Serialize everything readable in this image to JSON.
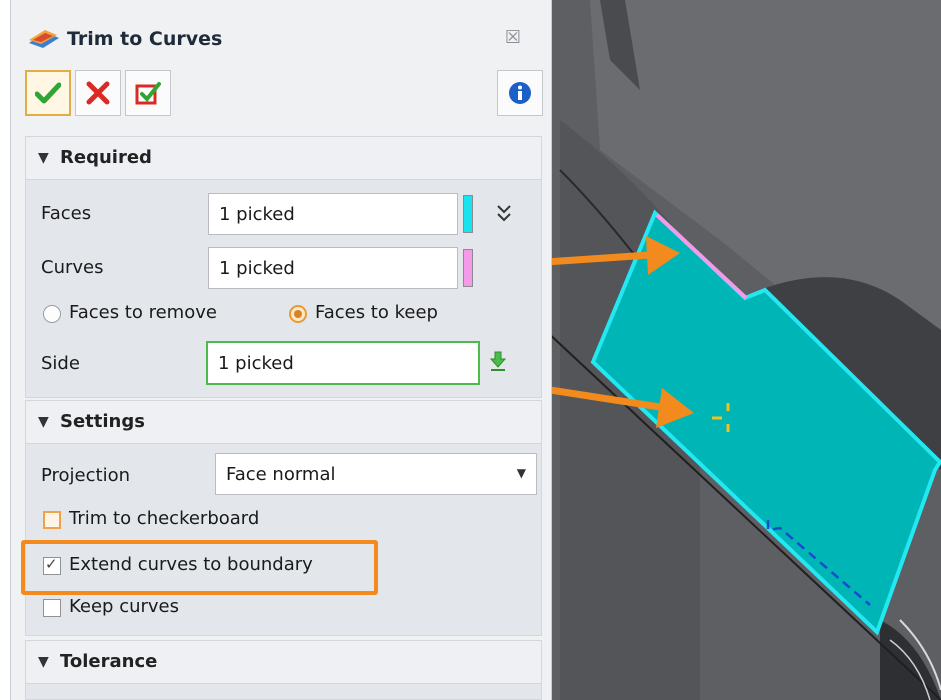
{
  "dialog": {
    "title": "Trim to Curves",
    "close_glyph": "☒",
    "toolbar": {
      "ok_icon": "checkmark-icon",
      "cancel_icon": "x-icon",
      "apply_icon": "apply-icon",
      "info_icon": "info-icon"
    }
  },
  "required": {
    "header": "Required",
    "faces": {
      "label": "Faces",
      "value": "1 picked",
      "swatch_color": "#19e3ef"
    },
    "curves": {
      "label": "Curves",
      "value": "1 picked",
      "swatch_color": "#f59ae8"
    },
    "faces_to_remove": "Faces to remove",
    "faces_to_keep": "Faces to keep",
    "side": {
      "label": "Side",
      "value": "1 picked"
    }
  },
  "settings": {
    "header": "Settings",
    "projection": {
      "label": "Projection",
      "value": "Face normal"
    },
    "trim_to_checkerboard": {
      "label": "Trim to checkerboard",
      "checked": false
    },
    "extend_curves": {
      "label": "Extend curves to boundary",
      "checked": true
    },
    "keep_curves": {
      "label": "Keep curves",
      "checked": false
    }
  },
  "tolerance": {
    "header": "Tolerance"
  },
  "colors": {
    "accent_orange": "#f28a1e",
    "face_cyan": "#00b4b4",
    "edge_cyan": "#19e3ef",
    "curve_pink": "#f59ae8"
  }
}
